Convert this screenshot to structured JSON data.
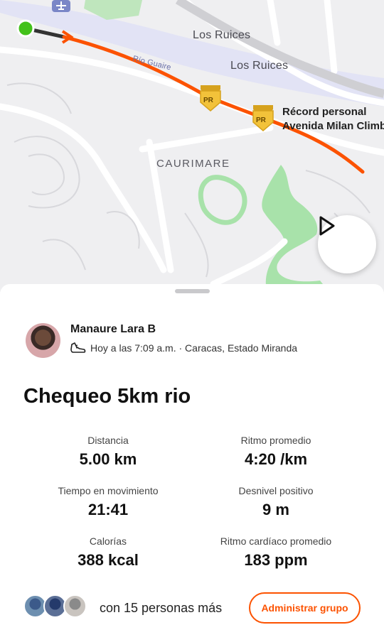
{
  "map": {
    "labels": {
      "los_ruices_1": "Los Ruices",
      "los_ruices_2": "Los Ruices",
      "caurimare": "CAURIMARE",
      "river": "Río Guaire"
    },
    "pr_badge_text": "PR",
    "pr_segment": {
      "line1": "Récord personal",
      "line2": "Avenida Milan Climb"
    },
    "route_color": "#fc5200",
    "start_color": "#43c11a",
    "park_color": "#9ee0a0",
    "water_color": "#e2e3f5",
    "play_icon": "play-icon",
    "airport_icon": "airplane-icon"
  },
  "activity": {
    "athlete_name": "Manaure Lara B",
    "sport_icon": "run-shoe-icon",
    "meta": "Hoy a las 7:09 a.m. · Caracas, Estado Miranda",
    "title": "Chequeo 5km rio"
  },
  "stats": [
    {
      "label": "Distancia",
      "value": "5.00 km"
    },
    {
      "label": "Ritmo promedio",
      "value": "4:20 /km"
    },
    {
      "label": "Tiempo en movimiento",
      "value": "21:41"
    },
    {
      "label": "Desnivel positivo",
      "value": "9 m"
    },
    {
      "label": "Calorías",
      "value": "388 kcal"
    },
    {
      "label": "Ritmo cardíaco promedio",
      "value": "183 ppm"
    }
  ],
  "group": {
    "text": "con 15 personas más",
    "manage_label": "Administrar grupo"
  },
  "colors": {
    "accent": "#fc5200"
  }
}
